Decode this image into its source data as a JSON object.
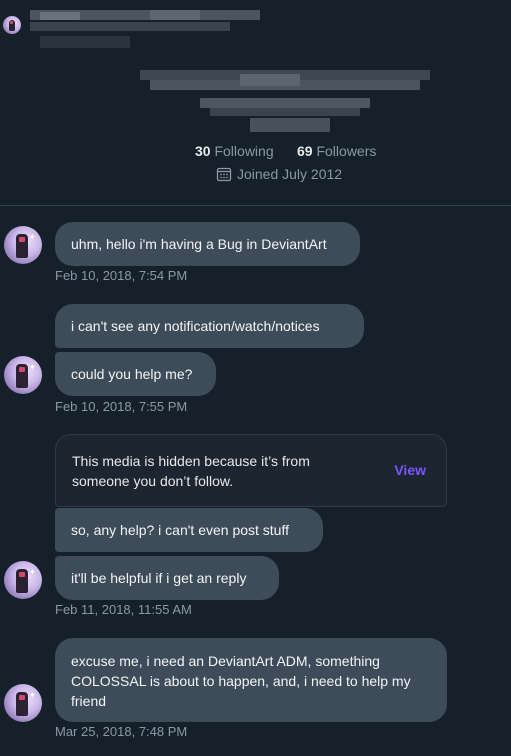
{
  "profile": {
    "following_count": "30",
    "following_label": "Following",
    "followers_count": "69",
    "followers_label": "Followers",
    "joined": "Joined July 2012",
    "calendar_icon": "calendar-icon"
  },
  "messages": [
    {
      "text": "uhm, hello i'm having a Bug in DeviantArt"
    },
    {
      "text": "i can't see any notification/watch/notices"
    },
    {
      "text": "could you help me?"
    },
    {
      "text": "so, any help? i can't even post stuff"
    },
    {
      "text": "it'll be helpful if i get an reply"
    },
    {
      "text": "excuse me, i need an DeviantArt ADM, something COLOSSAL is about to happen, and, i need to help my friend"
    }
  ],
  "timestamps": [
    "Feb 10, 2018, 7:54 PM",
    "Feb 10, 2018, 7:55 PM",
    "Feb 11, 2018, 11:55 AM",
    "Mar 25, 2018, 7:48 PM"
  ],
  "hidden_media": {
    "text": "This media is hidden because it’s from someone you don’t follow.",
    "action": "View"
  },
  "colors": {
    "background": "#15202b",
    "bubble": "#3e4c5a",
    "accent": "#7856ff"
  }
}
